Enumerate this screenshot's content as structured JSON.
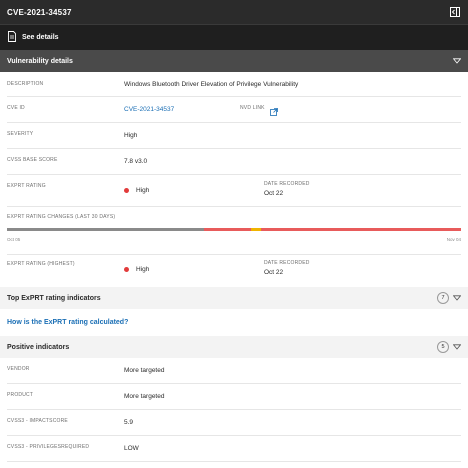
{
  "header": {
    "title": "CVE-2021-34537"
  },
  "actionbar": {
    "see_details": "See details"
  },
  "vuln_section": {
    "title": "Vulnerability details",
    "description_label": "DESCRIPTION",
    "description_value": "Windows Bluetooth Driver Elevation of Privilege Vulnerability",
    "cve_id_label": "CVE ID",
    "cve_id_value": "CVE-2021-34537",
    "nvd_link_label": "NVD LINK",
    "severity_label": "SEVERITY",
    "severity_value": "High",
    "cvss_label": "CVSS BASE SCORE",
    "cvss_value": "7.8 v3.0",
    "exprt_label": "EXPRT RATING",
    "exprt_value": "High",
    "date_recorded_label": "DATE RECORDED",
    "date_recorded_value": "Oct 22",
    "changes_label": "EXPRT RATING CHANGES (LAST 30 DAYS)",
    "axis_start": "Oct 05",
    "axis_end": "Nov 04",
    "highest_label": "EXPRT RATING (HIGHEST)",
    "highest_value": "High",
    "highest_date_label": "DATE RECORDED",
    "highest_date_value": "Oct 22",
    "rating_changes": {
      "segments": [
        {
          "rating": "none",
          "fraction": 0.434,
          "color": "#8a8a8a"
        },
        {
          "rating": "high",
          "fraction": 0.104,
          "color": "#e85b5b"
        },
        {
          "rating": "medium",
          "fraction": 0.022,
          "color": "#f0b400"
        },
        {
          "rating": "high",
          "fraction": 0.44,
          "color": "#e85b5b"
        }
      ]
    }
  },
  "top_indicators": {
    "title": "Top ExPRT rating indicators",
    "count": "7"
  },
  "calc_link": "How is the ExPRT rating calculated?",
  "positive": {
    "title": "Positive indicators",
    "count": "5",
    "rows": [
      {
        "label": "VENDOR",
        "value": "More targeted"
      },
      {
        "label": "PRODUCT",
        "value": "More targeted"
      },
      {
        "label": "CVSS3 - IMPACTSCORE",
        "value": "5.9"
      },
      {
        "label": "CVSS3 - PRIVILEGESREQUIRED",
        "value": "LOW"
      }
    ]
  },
  "colors": {
    "header": "#2b2b2b",
    "link": "#1b6fb5",
    "high": "#e23b3b"
  },
  "icons": [
    "sidebar-collapse-icon",
    "document-icon",
    "chevron-down-icon",
    "external-link-icon"
  ]
}
